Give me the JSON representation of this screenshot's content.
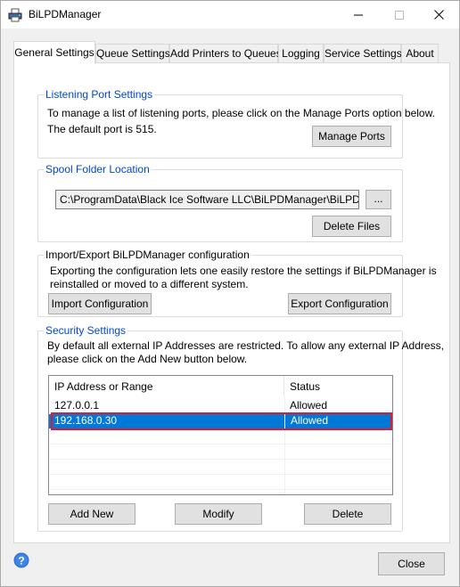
{
  "window": {
    "title": "BiLPDManager",
    "icons": {
      "app": "printer-icon",
      "minimize": "minimize-icon",
      "maximize": "maximize-icon",
      "close": "close-icon"
    }
  },
  "tabs": [
    {
      "label": "General Settings",
      "active": true
    },
    {
      "label": "Queue Settings",
      "active": false
    },
    {
      "label": "Add Printers to Queues",
      "active": false
    },
    {
      "label": "Logging",
      "active": false
    },
    {
      "label": "Service Settings",
      "active": false
    },
    {
      "label": "About",
      "active": false
    }
  ],
  "listening": {
    "title": "Listening Port Settings",
    "desc": "To manage a list of listening ports, please click on the Manage Ports option below.",
    "port_text": "The default port is 515.",
    "button": "Manage Ports"
  },
  "spool": {
    "title": "Spool Folder Location",
    "path": "C:\\ProgramData\\Black Ice Software LLC\\BiLPDManager\\BiLPD Spool",
    "browse": "...",
    "delete_button": "Delete Files"
  },
  "import_export": {
    "title": "Import/Export BiLPDManager configuration",
    "desc_line1": "Exporting the configuration lets one easily restore the settings if BiLPDManager is",
    "desc_line2": "reinstalled or moved to a different system.",
    "import_button": "Import Configuration",
    "export_button": "Export Configuration"
  },
  "security": {
    "title": "Security Settings",
    "desc_line1": "By default all external IP Addresses are restricted. To allow any external IP Address,",
    "desc_line2": "please click on the Add New button below.",
    "columns": [
      "IP Address or Range",
      "Status"
    ],
    "rows": [
      {
        "ip": "127.0.0.1",
        "status": "Allowed",
        "selected": false
      },
      {
        "ip": "192.168.0.30",
        "status": "Allowed",
        "selected": true
      }
    ],
    "add_button": "Add New",
    "modify_button": "Modify",
    "delete_button": "Delete"
  },
  "footer": {
    "help_icon": "help-icon",
    "close_button": "Close"
  },
  "colors": {
    "accent": "#0078d7",
    "group_title": "#0046d5",
    "highlight_outline": "#e0192e"
  }
}
